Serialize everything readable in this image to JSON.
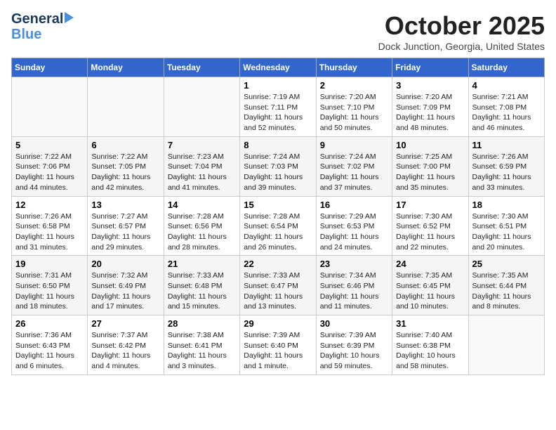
{
  "header": {
    "logo_line1": "General",
    "logo_line2": "Blue",
    "month": "October 2025",
    "location": "Dock Junction, Georgia, United States"
  },
  "weekdays": [
    "Sunday",
    "Monday",
    "Tuesday",
    "Wednesday",
    "Thursday",
    "Friday",
    "Saturday"
  ],
  "weeks": [
    [
      {
        "day": "",
        "content": ""
      },
      {
        "day": "",
        "content": ""
      },
      {
        "day": "",
        "content": ""
      },
      {
        "day": "1",
        "content": "Sunrise: 7:19 AM\nSunset: 7:11 PM\nDaylight: 11 hours\nand 52 minutes."
      },
      {
        "day": "2",
        "content": "Sunrise: 7:20 AM\nSunset: 7:10 PM\nDaylight: 11 hours\nand 50 minutes."
      },
      {
        "day": "3",
        "content": "Sunrise: 7:20 AM\nSunset: 7:09 PM\nDaylight: 11 hours\nand 48 minutes."
      },
      {
        "day": "4",
        "content": "Sunrise: 7:21 AM\nSunset: 7:08 PM\nDaylight: 11 hours\nand 46 minutes."
      }
    ],
    [
      {
        "day": "5",
        "content": "Sunrise: 7:22 AM\nSunset: 7:06 PM\nDaylight: 11 hours\nand 44 minutes."
      },
      {
        "day": "6",
        "content": "Sunrise: 7:22 AM\nSunset: 7:05 PM\nDaylight: 11 hours\nand 42 minutes."
      },
      {
        "day": "7",
        "content": "Sunrise: 7:23 AM\nSunset: 7:04 PM\nDaylight: 11 hours\nand 41 minutes."
      },
      {
        "day": "8",
        "content": "Sunrise: 7:24 AM\nSunset: 7:03 PM\nDaylight: 11 hours\nand 39 minutes."
      },
      {
        "day": "9",
        "content": "Sunrise: 7:24 AM\nSunset: 7:02 PM\nDaylight: 11 hours\nand 37 minutes."
      },
      {
        "day": "10",
        "content": "Sunrise: 7:25 AM\nSunset: 7:00 PM\nDaylight: 11 hours\nand 35 minutes."
      },
      {
        "day": "11",
        "content": "Sunrise: 7:26 AM\nSunset: 6:59 PM\nDaylight: 11 hours\nand 33 minutes."
      }
    ],
    [
      {
        "day": "12",
        "content": "Sunrise: 7:26 AM\nSunset: 6:58 PM\nDaylight: 11 hours\nand 31 minutes."
      },
      {
        "day": "13",
        "content": "Sunrise: 7:27 AM\nSunset: 6:57 PM\nDaylight: 11 hours\nand 29 minutes."
      },
      {
        "day": "14",
        "content": "Sunrise: 7:28 AM\nSunset: 6:56 PM\nDaylight: 11 hours\nand 28 minutes."
      },
      {
        "day": "15",
        "content": "Sunrise: 7:28 AM\nSunset: 6:54 PM\nDaylight: 11 hours\nand 26 minutes."
      },
      {
        "day": "16",
        "content": "Sunrise: 7:29 AM\nSunset: 6:53 PM\nDaylight: 11 hours\nand 24 minutes."
      },
      {
        "day": "17",
        "content": "Sunrise: 7:30 AM\nSunset: 6:52 PM\nDaylight: 11 hours\nand 22 minutes."
      },
      {
        "day": "18",
        "content": "Sunrise: 7:30 AM\nSunset: 6:51 PM\nDaylight: 11 hours\nand 20 minutes."
      }
    ],
    [
      {
        "day": "19",
        "content": "Sunrise: 7:31 AM\nSunset: 6:50 PM\nDaylight: 11 hours\nand 18 minutes."
      },
      {
        "day": "20",
        "content": "Sunrise: 7:32 AM\nSunset: 6:49 PM\nDaylight: 11 hours\nand 17 minutes."
      },
      {
        "day": "21",
        "content": "Sunrise: 7:33 AM\nSunset: 6:48 PM\nDaylight: 11 hours\nand 15 minutes."
      },
      {
        "day": "22",
        "content": "Sunrise: 7:33 AM\nSunset: 6:47 PM\nDaylight: 11 hours\nand 13 minutes."
      },
      {
        "day": "23",
        "content": "Sunrise: 7:34 AM\nSunset: 6:46 PM\nDaylight: 11 hours\nand 11 minutes."
      },
      {
        "day": "24",
        "content": "Sunrise: 7:35 AM\nSunset: 6:45 PM\nDaylight: 11 hours\nand 10 minutes."
      },
      {
        "day": "25",
        "content": "Sunrise: 7:35 AM\nSunset: 6:44 PM\nDaylight: 11 hours\nand 8 minutes."
      }
    ],
    [
      {
        "day": "26",
        "content": "Sunrise: 7:36 AM\nSunset: 6:43 PM\nDaylight: 11 hours\nand 6 minutes."
      },
      {
        "day": "27",
        "content": "Sunrise: 7:37 AM\nSunset: 6:42 PM\nDaylight: 11 hours\nand 4 minutes."
      },
      {
        "day": "28",
        "content": "Sunrise: 7:38 AM\nSunset: 6:41 PM\nDaylight: 11 hours\nand 3 minutes."
      },
      {
        "day": "29",
        "content": "Sunrise: 7:39 AM\nSunset: 6:40 PM\nDaylight: 11 hours\nand 1 minute."
      },
      {
        "day": "30",
        "content": "Sunrise: 7:39 AM\nSunset: 6:39 PM\nDaylight: 10 hours\nand 59 minutes."
      },
      {
        "day": "31",
        "content": "Sunrise: 7:40 AM\nSunset: 6:38 PM\nDaylight: 10 hours\nand 58 minutes."
      },
      {
        "day": "",
        "content": ""
      }
    ]
  ]
}
